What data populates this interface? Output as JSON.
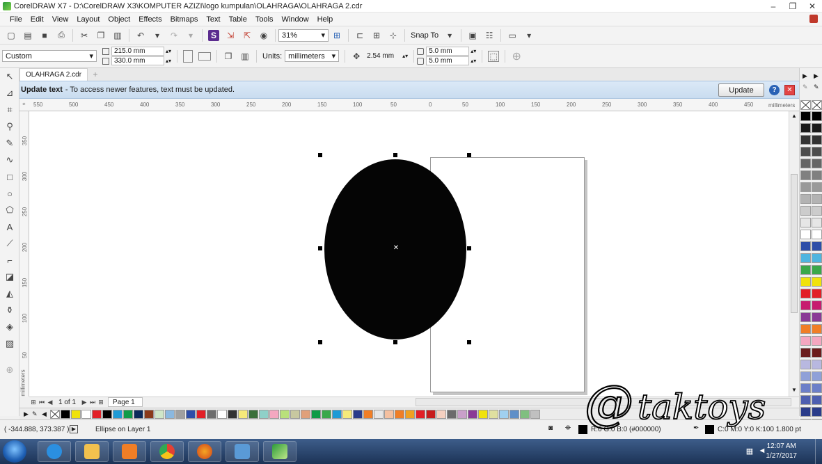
{
  "window": {
    "title": "CorelDRAW X7 - D:\\CorelDRAW X3\\KOMPUTER  AZIZI\\logo kumpulan\\OLAHRAGA\\OLAHRAGA 2.cdr",
    "minimize": "–",
    "maximize": "❐",
    "close": "✕"
  },
  "menu": [
    "File",
    "Edit",
    "View",
    "Layout",
    "Object",
    "Effects",
    "Bitmaps",
    "Text",
    "Table",
    "Tools",
    "Window",
    "Help"
  ],
  "toolbar": {
    "zoom_value": "31%",
    "snap_label": "Snap To"
  },
  "propbar": {
    "preset": "Custom",
    "width": "215.0 mm",
    "height": "330.0 mm",
    "units_label": "Units:",
    "units_value": "millimeters",
    "nudge": "2.54 mm",
    "dup_x": "5.0 mm",
    "dup_y": "5.0 mm"
  },
  "document": {
    "tab": "OLAHRAGA 2.cdr"
  },
  "banner": {
    "title": "Update text",
    "message": "-  To access newer features, text must be updated.",
    "button": "Update",
    "help": "?",
    "close": "✕"
  },
  "ruler": {
    "h_ticks": [
      "550",
      "500",
      "450",
      "400",
      "350",
      "300",
      "250",
      "200",
      "150",
      "100",
      "50",
      "0",
      "50",
      "100",
      "150",
      "200",
      "250",
      "300",
      "350",
      "400",
      "450"
    ],
    "h_unit": "millimeters",
    "v_ticks": [
      "350",
      "300",
      "250",
      "200",
      "150",
      "100",
      "50"
    ],
    "v_unit": "millimeters"
  },
  "pagenav": {
    "count": "1 of 1",
    "page_tab": "Page 1"
  },
  "palette_right": [
    "#000000",
    "#1a1a1a",
    "#333333",
    "#4d4d4d",
    "#666666",
    "#808080",
    "#999999",
    "#b3b3b3",
    "#cccccc",
    "#e6e6e6",
    "#ffffff",
    "#2e4ea8",
    "#4fb5e0",
    "#3aa84a",
    "#f0e20c",
    "#e21f26",
    "#c71c6f",
    "#8a3a96",
    "#f07e26",
    "#f4a7c0",
    "#6b1d1d",
    "#b8b8e0",
    "#8fa0d8",
    "#6c7fc8",
    "#4e5fb0",
    "#2a3c8a",
    "#1c2a66"
  ],
  "palette_bottom": [
    "#000000",
    "#f0e20c",
    "#ffffff",
    "#e21f26",
    "#000000",
    "#1c9ad6",
    "#0e9b47",
    "#0b2a5b",
    "#8a3a1a",
    "#cfe6c8",
    "#8ab8e0",
    "#a0a0a0",
    "#2e4ea8",
    "#e21f26",
    "#6d6d6d",
    "#ffffff",
    "#333333",
    "#f5e97a",
    "#3a6e3a",
    "#8fd0c8",
    "#f4a7c0",
    "#b9e07a",
    "#c8c8a0",
    "#e0a07a",
    "#0e9b47",
    "#3aa84a",
    "#1c9ad6",
    "#f5e97a",
    "#2a3c8a",
    "#f07e26",
    "#e6e6e6",
    "#f4c0a0",
    "#f07e26",
    "#f0a020",
    "#e21f26",
    "#c71c1c",
    "#f5d0c0",
    "#6b6b6b",
    "#c9a0c9",
    "#8a3a96",
    "#f0e20c",
    "#e0e0a0",
    "#a0d0f0",
    "#5f8fc8",
    "#7fbf7f",
    "#c0c0c0"
  ],
  "status": {
    "coords": "( -344.888, 373.387 )",
    "object": "Ellipse on Layer 1",
    "fill_info": "R:0 G:0 B:0 (#000000)",
    "outline_info": "C:0 M:0 Y:0 K:100  1.800 pt"
  },
  "taskbar": {
    "time": "12:07 AM",
    "date": "1/27/2017"
  },
  "watermark": {
    "text": "@taktoys"
  }
}
